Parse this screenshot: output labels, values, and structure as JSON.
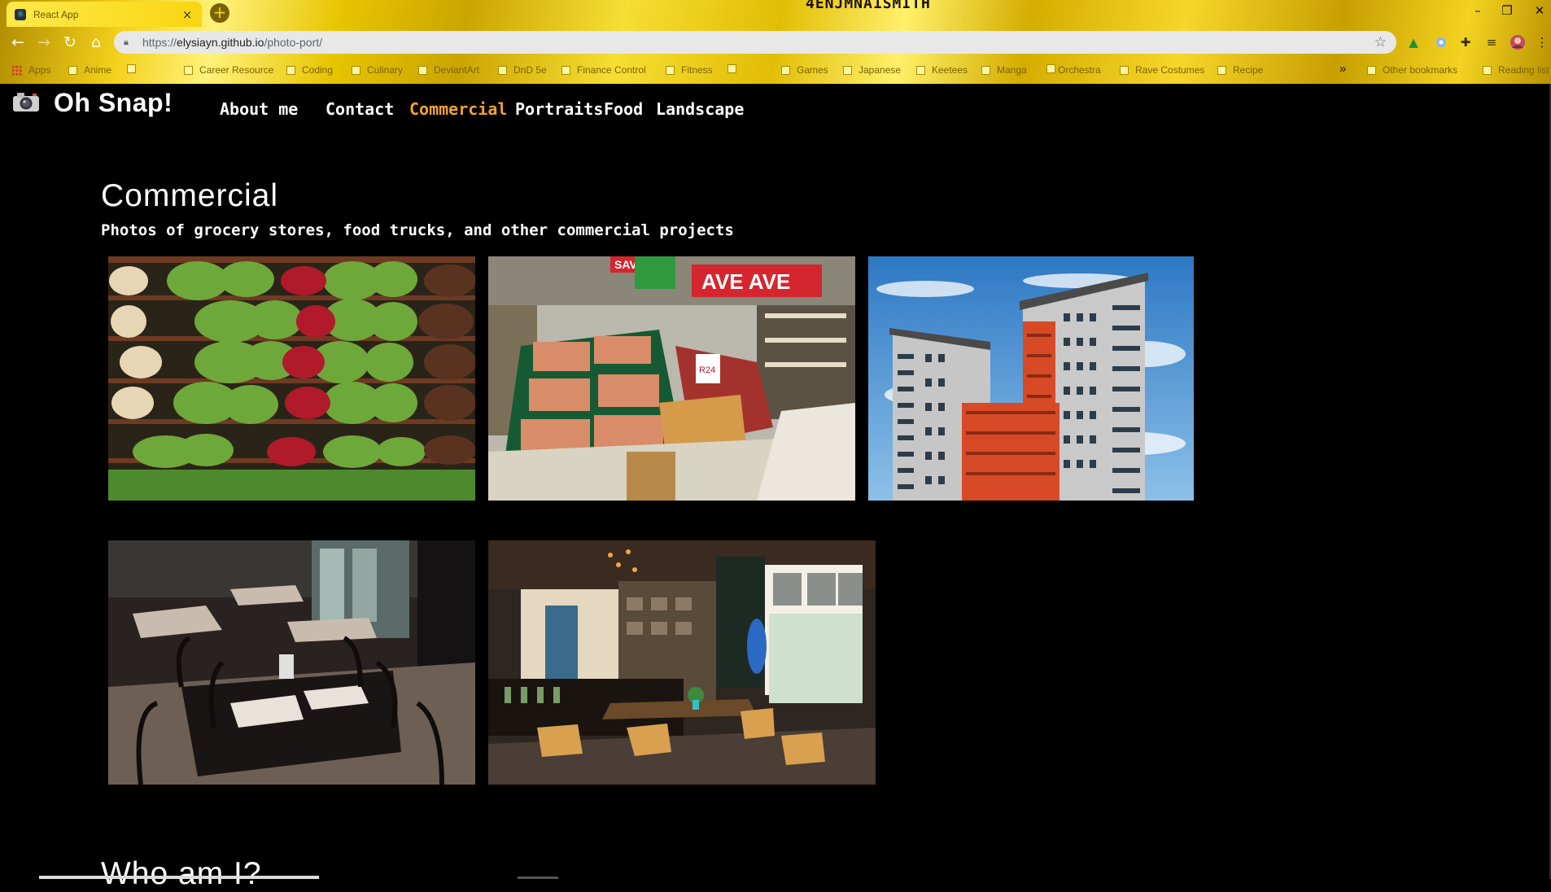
{
  "browser": {
    "tab_title": "React App",
    "tab_close": "×",
    "new_tab": "+",
    "title_decoration": "4ENJMNA1SMITH",
    "window_controls": {
      "minimize": "–",
      "restore": "❐",
      "close": "✕"
    },
    "nav": {
      "back": "←",
      "forward": "→",
      "reload": "↻",
      "home": "⌂"
    },
    "url_prefix": "https://",
    "url_host": "elysiayn.github.io",
    "url_path": "/photo-port/",
    "bookmark_star": "☆",
    "bookmarks": [
      "Apps",
      "Anime",
      "",
      "Career Resource",
      "Coding",
      "Culinary",
      "DeviantArt",
      "DnD 5e",
      "Finance Control",
      "Fitness",
      "",
      "Games",
      "Japanese",
      "Keetees",
      "Manga",
      "",
      "Orchestra",
      "Rave Costumes",
      "Recipe"
    ],
    "bookmarks_overflow": "»",
    "other_bookmarks": "Other bookmarks",
    "reading_list": "Reading list",
    "icons": [
      "lock-icon",
      "star-icon",
      "drive-icon",
      "circle-extension-icon",
      "puzzle-extension-icon",
      "media-icon",
      "profile-avatar-icon",
      "kebab-menu-icon"
    ]
  },
  "site": {
    "logo_icon": "camera-icon",
    "title": "Oh Snap!",
    "nav": [
      "About me",
      "Contact",
      "Commercial",
      "Portraits",
      "Food",
      "Landscape"
    ],
    "active_nav": "Commercial",
    "accent_color": "#f2a233"
  },
  "section": {
    "title": "Commercial",
    "description": "Photos of grocery stores, food trucks, and other commercial projects"
  },
  "photos": [
    {
      "subject": "grocery-produce-shelves"
    },
    {
      "subject": "grocery-fruit-aisle"
    },
    {
      "subject": "apartment-building"
    },
    {
      "subject": "restaurant-dining-room"
    },
    {
      "subject": "cafe-interior"
    }
  ],
  "next_section": {
    "title": "Who am I?"
  }
}
